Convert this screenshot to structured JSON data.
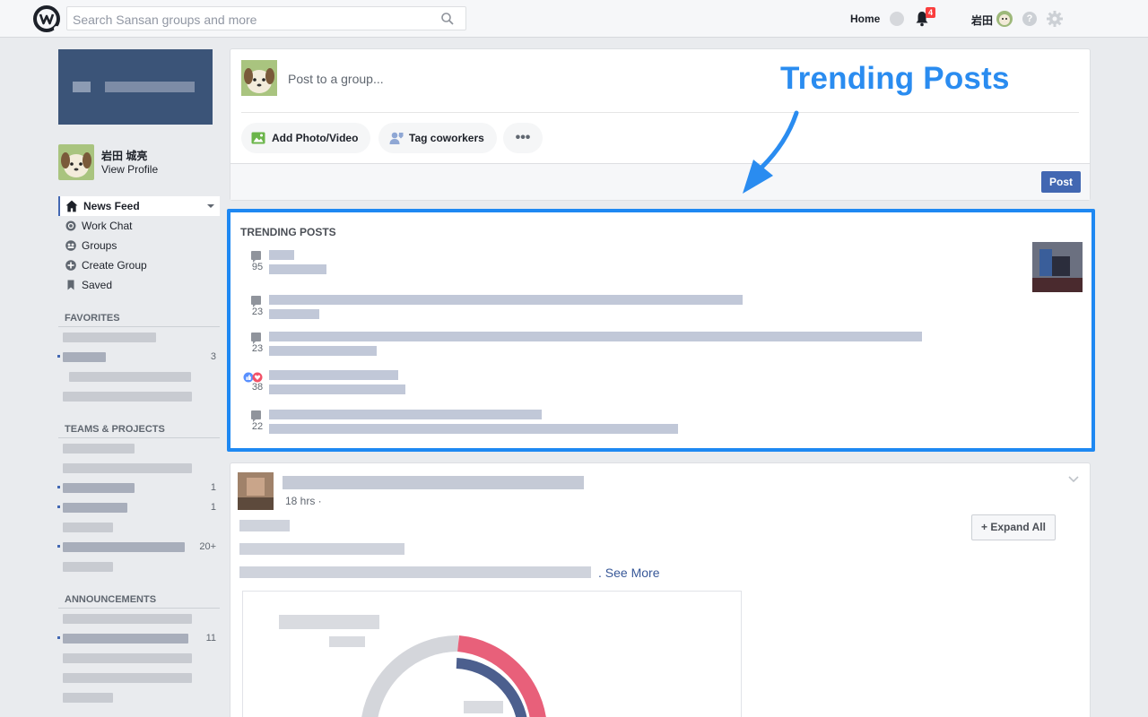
{
  "topbar": {
    "search_placeholder": "Search Sansan groups and more",
    "home_label": "Home",
    "notification_count": "4",
    "user_short": "岩田",
    "help_label": "?"
  },
  "sidebar": {
    "profile_name": "岩田 城亮",
    "view_profile": "View Profile",
    "menu": [
      {
        "label": "News Feed",
        "icon": "home-icon"
      },
      {
        "label": "Work Chat",
        "icon": "chat-icon"
      },
      {
        "label": "Groups",
        "icon": "groups-icon"
      },
      {
        "label": "Create Group",
        "icon": "plus-icon"
      },
      {
        "label": "Saved",
        "icon": "bookmark-icon"
      }
    ],
    "favorites_header": "FAVORITES",
    "favorites_counts": [
      "3"
    ],
    "teams_header": "TEAMS & PROJECTS",
    "teams_counts": [
      "1",
      "1",
      "20+"
    ],
    "announcements_header": "ANNOUNCEMENTS",
    "announcements_counts": [
      "11"
    ]
  },
  "composer": {
    "placeholder": "Post to a group...",
    "add_photo": "Add Photo/Video",
    "tag_coworkers": "Tag coworkers",
    "more": "•••",
    "post_button": "Post"
  },
  "annotation": {
    "label": "Trending Posts"
  },
  "trending": {
    "title": "TRENDING POSTS",
    "counts": [
      "95",
      "23",
      "23",
      "38",
      "22"
    ]
  },
  "post": {
    "time": "18 hrs ·",
    "expand_all": "+ Expand All",
    "see_more": ". See More"
  },
  "colors": {
    "accent": "#4267b2",
    "highlight": "#1e88f2",
    "badge": "#fa3e3e"
  }
}
